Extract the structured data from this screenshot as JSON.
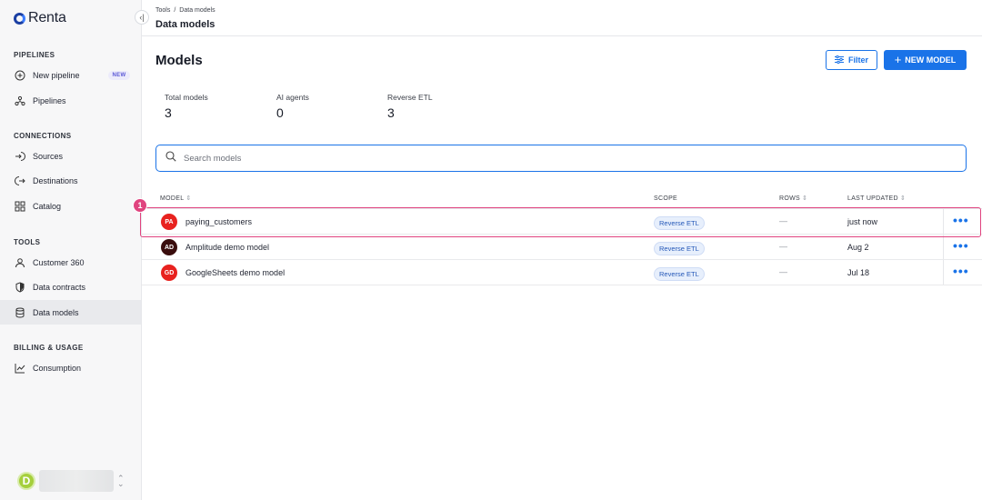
{
  "app": {
    "logo_text": "Renta"
  },
  "sidebar": {
    "sections": [
      {
        "title": "PIPELINES"
      },
      {
        "title": "CONNECTIONS"
      },
      {
        "title": "TOOLS"
      },
      {
        "title": "BILLING & USAGE"
      }
    ],
    "items": [
      {
        "label": "New pipeline",
        "icon": "plus-circle-icon",
        "badge": "NEW"
      },
      {
        "label": "Pipelines",
        "icon": "pipelines-icon"
      },
      {
        "label": "Sources",
        "icon": "source-icon"
      },
      {
        "label": "Destinations",
        "icon": "destination-icon"
      },
      {
        "label": "Catalog",
        "icon": "catalog-grid-icon"
      },
      {
        "label": "Customer 360",
        "icon": "user-icon"
      },
      {
        "label": "Data contracts",
        "icon": "shield-icon"
      },
      {
        "label": "Data models",
        "icon": "database-icon",
        "active": true
      },
      {
        "label": "Consumption",
        "icon": "chart-line-icon"
      }
    ],
    "user": {
      "avatar_initial": "D",
      "avatar_color": "#a5cf3c"
    }
  },
  "header": {
    "breadcrumb": [
      "Tools",
      "Data models"
    ],
    "breadcrumb_sep": "/",
    "title": "Data models"
  },
  "main": {
    "title": "Models",
    "filter_label": "Filter",
    "new_model_label": "NEW MODEL",
    "stats": [
      {
        "label": "Total models",
        "value": "3"
      },
      {
        "label": "AI agents",
        "value": "0"
      },
      {
        "label": "Reverse ETL",
        "value": "3"
      }
    ],
    "search_placeholder": "Search models",
    "columns": [
      "MODEL",
      "SCOPE",
      "ROWS",
      "LAST UPDATED"
    ],
    "rows": [
      {
        "initials": "PA",
        "avatar_color": "#e8221f",
        "name": "paying_customers",
        "scope": "Reverse ETL",
        "rows": "—",
        "updated": "just now",
        "menu": "•••"
      },
      {
        "initials": "AD",
        "avatar_color": "#3a0d0d",
        "name": "Amplitude demo model",
        "scope": "Reverse ETL",
        "rows": "—",
        "updated": "Aug 2",
        "menu": "•••"
      },
      {
        "initials": "GD",
        "avatar_color": "#e8221f",
        "name": "GoogleSheets demo model",
        "scope": "Reverse ETL",
        "rows": "—",
        "updated": "Jul 18",
        "menu": "•••"
      }
    ],
    "highlight_step": "1"
  },
  "colors": {
    "accent": "#1a73e8",
    "highlight": "#e0447f"
  }
}
